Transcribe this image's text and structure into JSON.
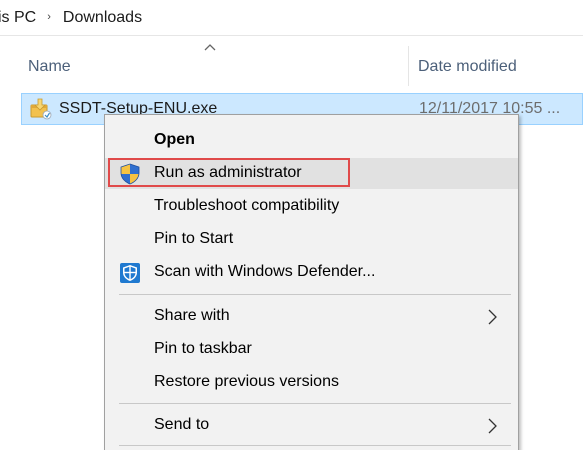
{
  "breadcrumb": {
    "items": [
      "is PC",
      "Downloads"
    ],
    "separator": "›"
  },
  "columns": {
    "name": "Name",
    "date_modified": "Date modified",
    "sort_indicator": "ascending"
  },
  "file": {
    "name": "SSDT-Setup-ENU.exe",
    "date": "12/11/2017 10:55 ...",
    "icon": "setup-exe-icon",
    "selected": true
  },
  "context_menu": {
    "items": [
      {
        "label": "Open",
        "bold": true,
        "icon": null,
        "submenu": false
      },
      {
        "label": "Run as administrator",
        "bold": false,
        "icon": "uac-shield-icon",
        "submenu": false,
        "highlighted": true
      },
      {
        "label": "Troubleshoot compatibility",
        "bold": false,
        "icon": null,
        "submenu": false
      },
      {
        "label": "Pin to Start",
        "bold": false,
        "icon": null,
        "submenu": false
      },
      {
        "label": "Scan with Windows Defender...",
        "bold": false,
        "icon": "windows-defender-icon",
        "submenu": false
      },
      {
        "label": "Share with",
        "bold": false,
        "icon": null,
        "submenu": true
      },
      {
        "label": "Pin to taskbar",
        "bold": false,
        "icon": null,
        "submenu": false
      },
      {
        "label": "Restore previous versions",
        "bold": false,
        "icon": null,
        "submenu": false
      },
      {
        "label": "Send to",
        "bold": false,
        "icon": null,
        "submenu": true
      }
    ]
  },
  "colors": {
    "selection_bg": "#cce8ff",
    "selection_border": "#99d1ff",
    "menu_bg": "#f2f2f2",
    "menu_hover": "#e1e1e1",
    "annotation_red": "#e04a4a",
    "header_text": "#4c607a"
  }
}
